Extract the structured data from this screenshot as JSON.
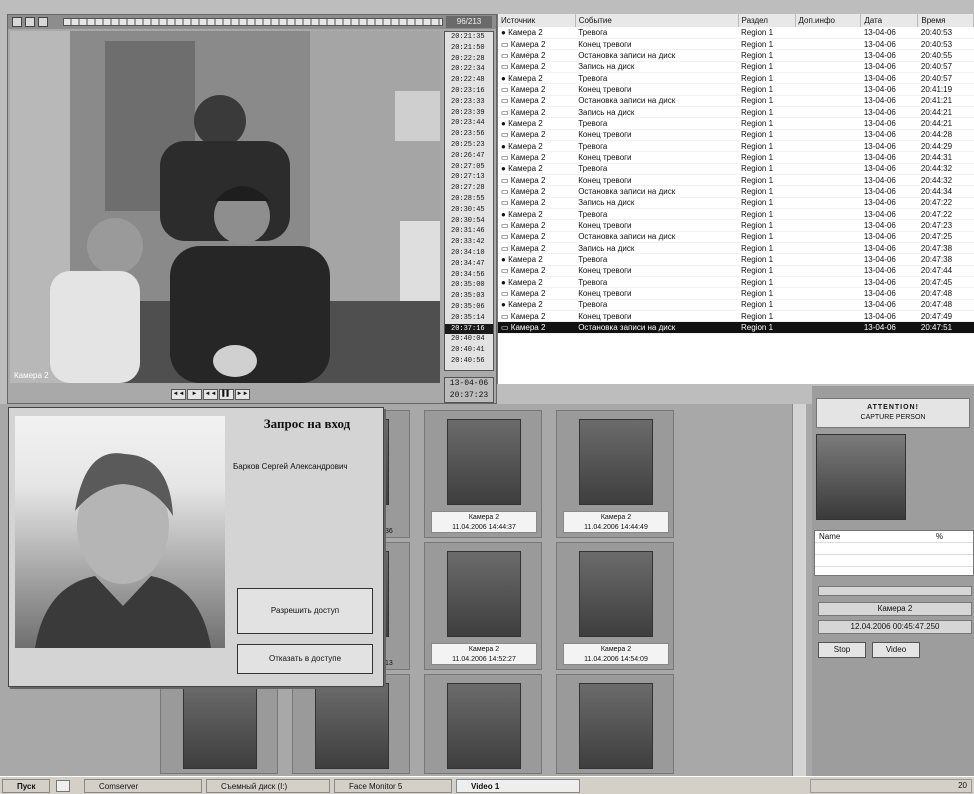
{
  "video": {
    "counter": "96/213",
    "camera_label": "Камера 2",
    "date": "13-04-06",
    "time": "20:37:23",
    "timestamps": [
      "20:21:35",
      "20:21:50",
      "20:22:28",
      "20:22:34",
      "20:22:48",
      "20:23:16",
      "20:23:33",
      "20:23:39",
      "20:23:44",
      "20:23:56",
      "20:25:23",
      "20:26:47",
      "20:27:05",
      "20:27:13",
      "20:27:28",
      "20:28:55",
      "20:30:45",
      "20:30:54",
      "20:31:46",
      "20:33:42",
      "20:34:10",
      "20:34:47",
      "20:34:56",
      "20:35:00",
      "20:35:03",
      "20:35:06",
      "20:35:14",
      "20:37:16",
      "20:40:04",
      "20:40:41",
      "20:40:56"
    ],
    "selected_timestamp": "20:37:16",
    "controls": [
      "◄◄",
      "►",
      "◄◄",
      "▌▌",
      "►►"
    ]
  },
  "events": {
    "columns": [
      "Источник",
      "Событие",
      "Раздел",
      "Доп.инфо",
      "Дата",
      "Время"
    ],
    "rows": [
      [
        "Камера 2",
        "Тревога",
        "Region 1",
        "",
        "13-04-06",
        "20:40:53"
      ],
      [
        "Камера 2",
        "Конец тревоги",
        "Region 1",
        "",
        "13-04-06",
        "20:40:53"
      ],
      [
        "Камера 2",
        "Остановка записи на диск",
        "Region 1",
        "",
        "13-04-06",
        "20:40:55"
      ],
      [
        "Камера 2",
        "Запись на диск",
        "Region 1",
        "",
        "13-04-06",
        "20:40:57"
      ],
      [
        "Камера 2",
        "Тревога",
        "Region 1",
        "",
        "13-04-06",
        "20:40:57"
      ],
      [
        "Камера 2",
        "Конец тревоги",
        "Region 1",
        "",
        "13-04-06",
        "20:41:19"
      ],
      [
        "Камера 2",
        "Остановка записи на диск",
        "Region 1",
        "",
        "13-04-06",
        "20:41:21"
      ],
      [
        "Камера 2",
        "Запись на диск",
        "Region 1",
        "",
        "13-04-06",
        "20:44:21"
      ],
      [
        "Камера 2",
        "Тревога",
        "Region 1",
        "",
        "13-04-06",
        "20:44:21"
      ],
      [
        "Камера 2",
        "Конец тревоги",
        "Region 1",
        "",
        "13-04-06",
        "20:44:28"
      ],
      [
        "Камера 2",
        "Тревога",
        "Region 1",
        "",
        "13-04-06",
        "20:44:29"
      ],
      [
        "Камера 2",
        "Конец тревоги",
        "Region 1",
        "",
        "13-04-06",
        "20:44:31"
      ],
      [
        "Камера 2",
        "Тревога",
        "Region 1",
        "",
        "13-04-06",
        "20:44:32"
      ],
      [
        "Камера 2",
        "Конец тревоги",
        "Region 1",
        "",
        "13-04-06",
        "20:44:32"
      ],
      [
        "Камера 2",
        "Остановка записи на диск",
        "Region 1",
        "",
        "13-04-06",
        "20:44:34"
      ],
      [
        "Камера 2",
        "Запись на диск",
        "Region 1",
        "",
        "13-04-06",
        "20:47:22"
      ],
      [
        "Камера 2",
        "Тревога",
        "Region 1",
        "",
        "13-04-06",
        "20:47:22"
      ],
      [
        "Камера 2",
        "Конец тревоги",
        "Region 1",
        "",
        "13-04-06",
        "20:47:23"
      ],
      [
        "Камера 2",
        "Остановка записи на диск",
        "Region 1",
        "",
        "13-04-06",
        "20:47:25"
      ],
      [
        "Камера 2",
        "Запись на диск",
        "Region 1",
        "",
        "13-04-06",
        "20:47:38"
      ],
      [
        "Камера 2",
        "Тревога",
        "Region 1",
        "",
        "13-04-06",
        "20:47:38"
      ],
      [
        "Камера 2",
        "Конец тревоги",
        "Region 1",
        "",
        "13-04-06",
        "20:47:44"
      ],
      [
        "Камера 2",
        "Тревога",
        "Region 1",
        "",
        "13-04-06",
        "20:47:45"
      ],
      [
        "Камера 2",
        "Конец тревоги",
        "Region 1",
        "",
        "13-04-06",
        "20:47:48"
      ],
      [
        "Камера 2",
        "Тревога",
        "Region 1",
        "",
        "13-04-06",
        "20:47:48"
      ],
      [
        "Камера 2",
        "Конец тревоги",
        "Region 1",
        "",
        "13-04-06",
        "20:47:49"
      ],
      [
        "Камера 2",
        "Остановка записи на диск",
        "Region 1",
        "",
        "13-04-06",
        "20:47:51"
      ]
    ],
    "selected_row": 26
  },
  "dialog": {
    "title": "Запрос на вход",
    "person_name": "Барков Сергей Александрович",
    "allow_label": "Разрешить доступ",
    "deny_label": "Отказать в доступе"
  },
  "thumbnails": [
    {
      "cap1": "",
      "cap2": ""
    },
    {
      "cap1": "Камера 2",
      "cap2": "11.04.2006 14:44:37"
    },
    {
      "cap1": "Камера 2",
      "cap2": "11.04.2006 14:44:49"
    },
    {
      "cap1": "Камера 2",
      "cap2": "11.04.2006 14:52:27"
    },
    {
      "cap1": "Камера 2",
      "cap2": "11.04.2006 14:54:09"
    }
  ],
  "partial_captions": [
    "36",
    "13"
  ],
  "right_panel": {
    "attention": "ATTENTION!",
    "capture": "CAPTURE PERSON",
    "table_header_name": "Name",
    "table_header_pct": "%",
    "camera": "Камера 2",
    "datetime": "12.04.2006 00:45:47.250",
    "stop_label": "Stop",
    "video_label": "Video"
  },
  "taskbar": {
    "start": "Пуск",
    "tasks": [
      "Comserver",
      "Съемный диск (I:)",
      "Face Monitor 5",
      "Video 1"
    ],
    "active_task": "Video 1",
    "tray_text": "20"
  }
}
